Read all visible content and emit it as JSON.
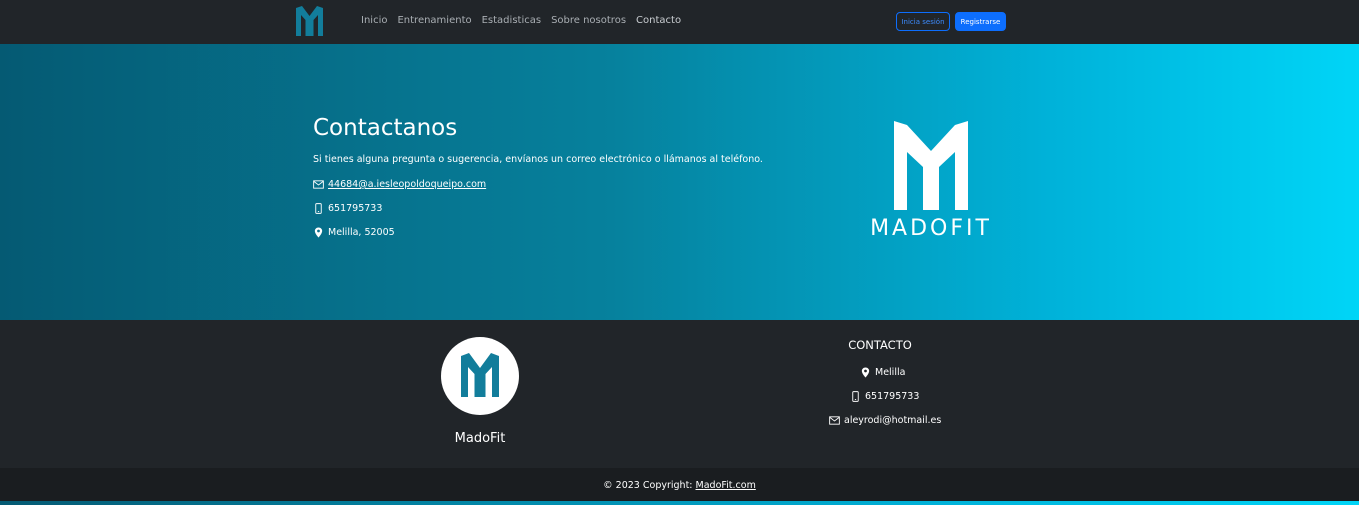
{
  "nav": {
    "links": [
      "Inicio",
      "Entrenamiento",
      "Estadisticas",
      "Sobre nosotros",
      "Contacto"
    ],
    "login_label": "Inicia sesión",
    "register_label": "Registrarse"
  },
  "hero": {
    "title": "Contactanos",
    "text": "Si tienes alguna pregunta o sugerencia, envíanos un correo electrónico o llámanos al teléfono.",
    "email": "44684@a.iesleopoldoqueipo.com",
    "phone": "651795733",
    "location": "Melilla, 52005",
    "logo_text": "MADOFIT"
  },
  "footer": {
    "brand": "MadoFit",
    "contact_title": "CONTACTO",
    "location": "Melilla",
    "phone": "651795733",
    "email": "aleyrodi@hotmail.es"
  },
  "copyright": {
    "prefix": "© 2023 Copyright: ",
    "link": "MadoFit.com"
  },
  "icons": {
    "envelope": "envelope-icon",
    "phone": "phone-icon",
    "location": "location-pin-icon"
  },
  "colors": {
    "navbar": "#212529",
    "primary": "#0d6efd",
    "brand_teal": "#127d9b",
    "gradient_start": "#055a73",
    "gradient_end": "#00d5f7"
  }
}
